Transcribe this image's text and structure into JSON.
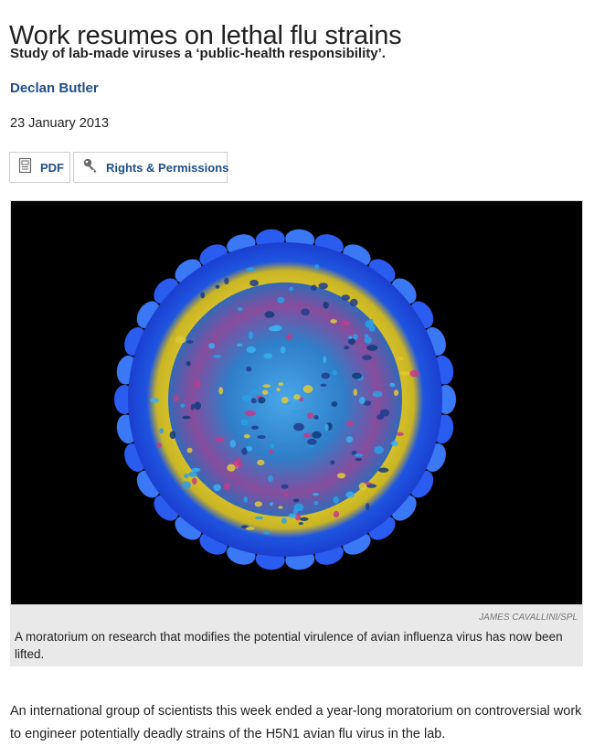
{
  "article": {
    "title": "Work resumes on lethal flu strains",
    "standfirst": "Study of lab-made viruses a ‘public-health responsibility’.",
    "author": "Declan Butler",
    "date": "23 January 2013"
  },
  "actions": {
    "pdf_label": "PDF",
    "rights_label": "Rights & Permissions"
  },
  "figure": {
    "credit": "JAMES CAVALLINI/SPL",
    "caption": "A moratorium on research that modifies the potential virulence of avian influenza virus has now been lifted."
  },
  "body": {
    "paragraph_1": "An international group of scientists this week ended a year-long moratorium on controversial work to engineer potentially deadly strains of the H5N1 avian flu virus in the lab."
  },
  "colors": {
    "link": "#1f4e8c",
    "caption_bg": "#e9e9e9",
    "image_bg": "#000000"
  },
  "icons": {
    "pdf": "pdf-document-icon",
    "rights": "key-icon"
  }
}
